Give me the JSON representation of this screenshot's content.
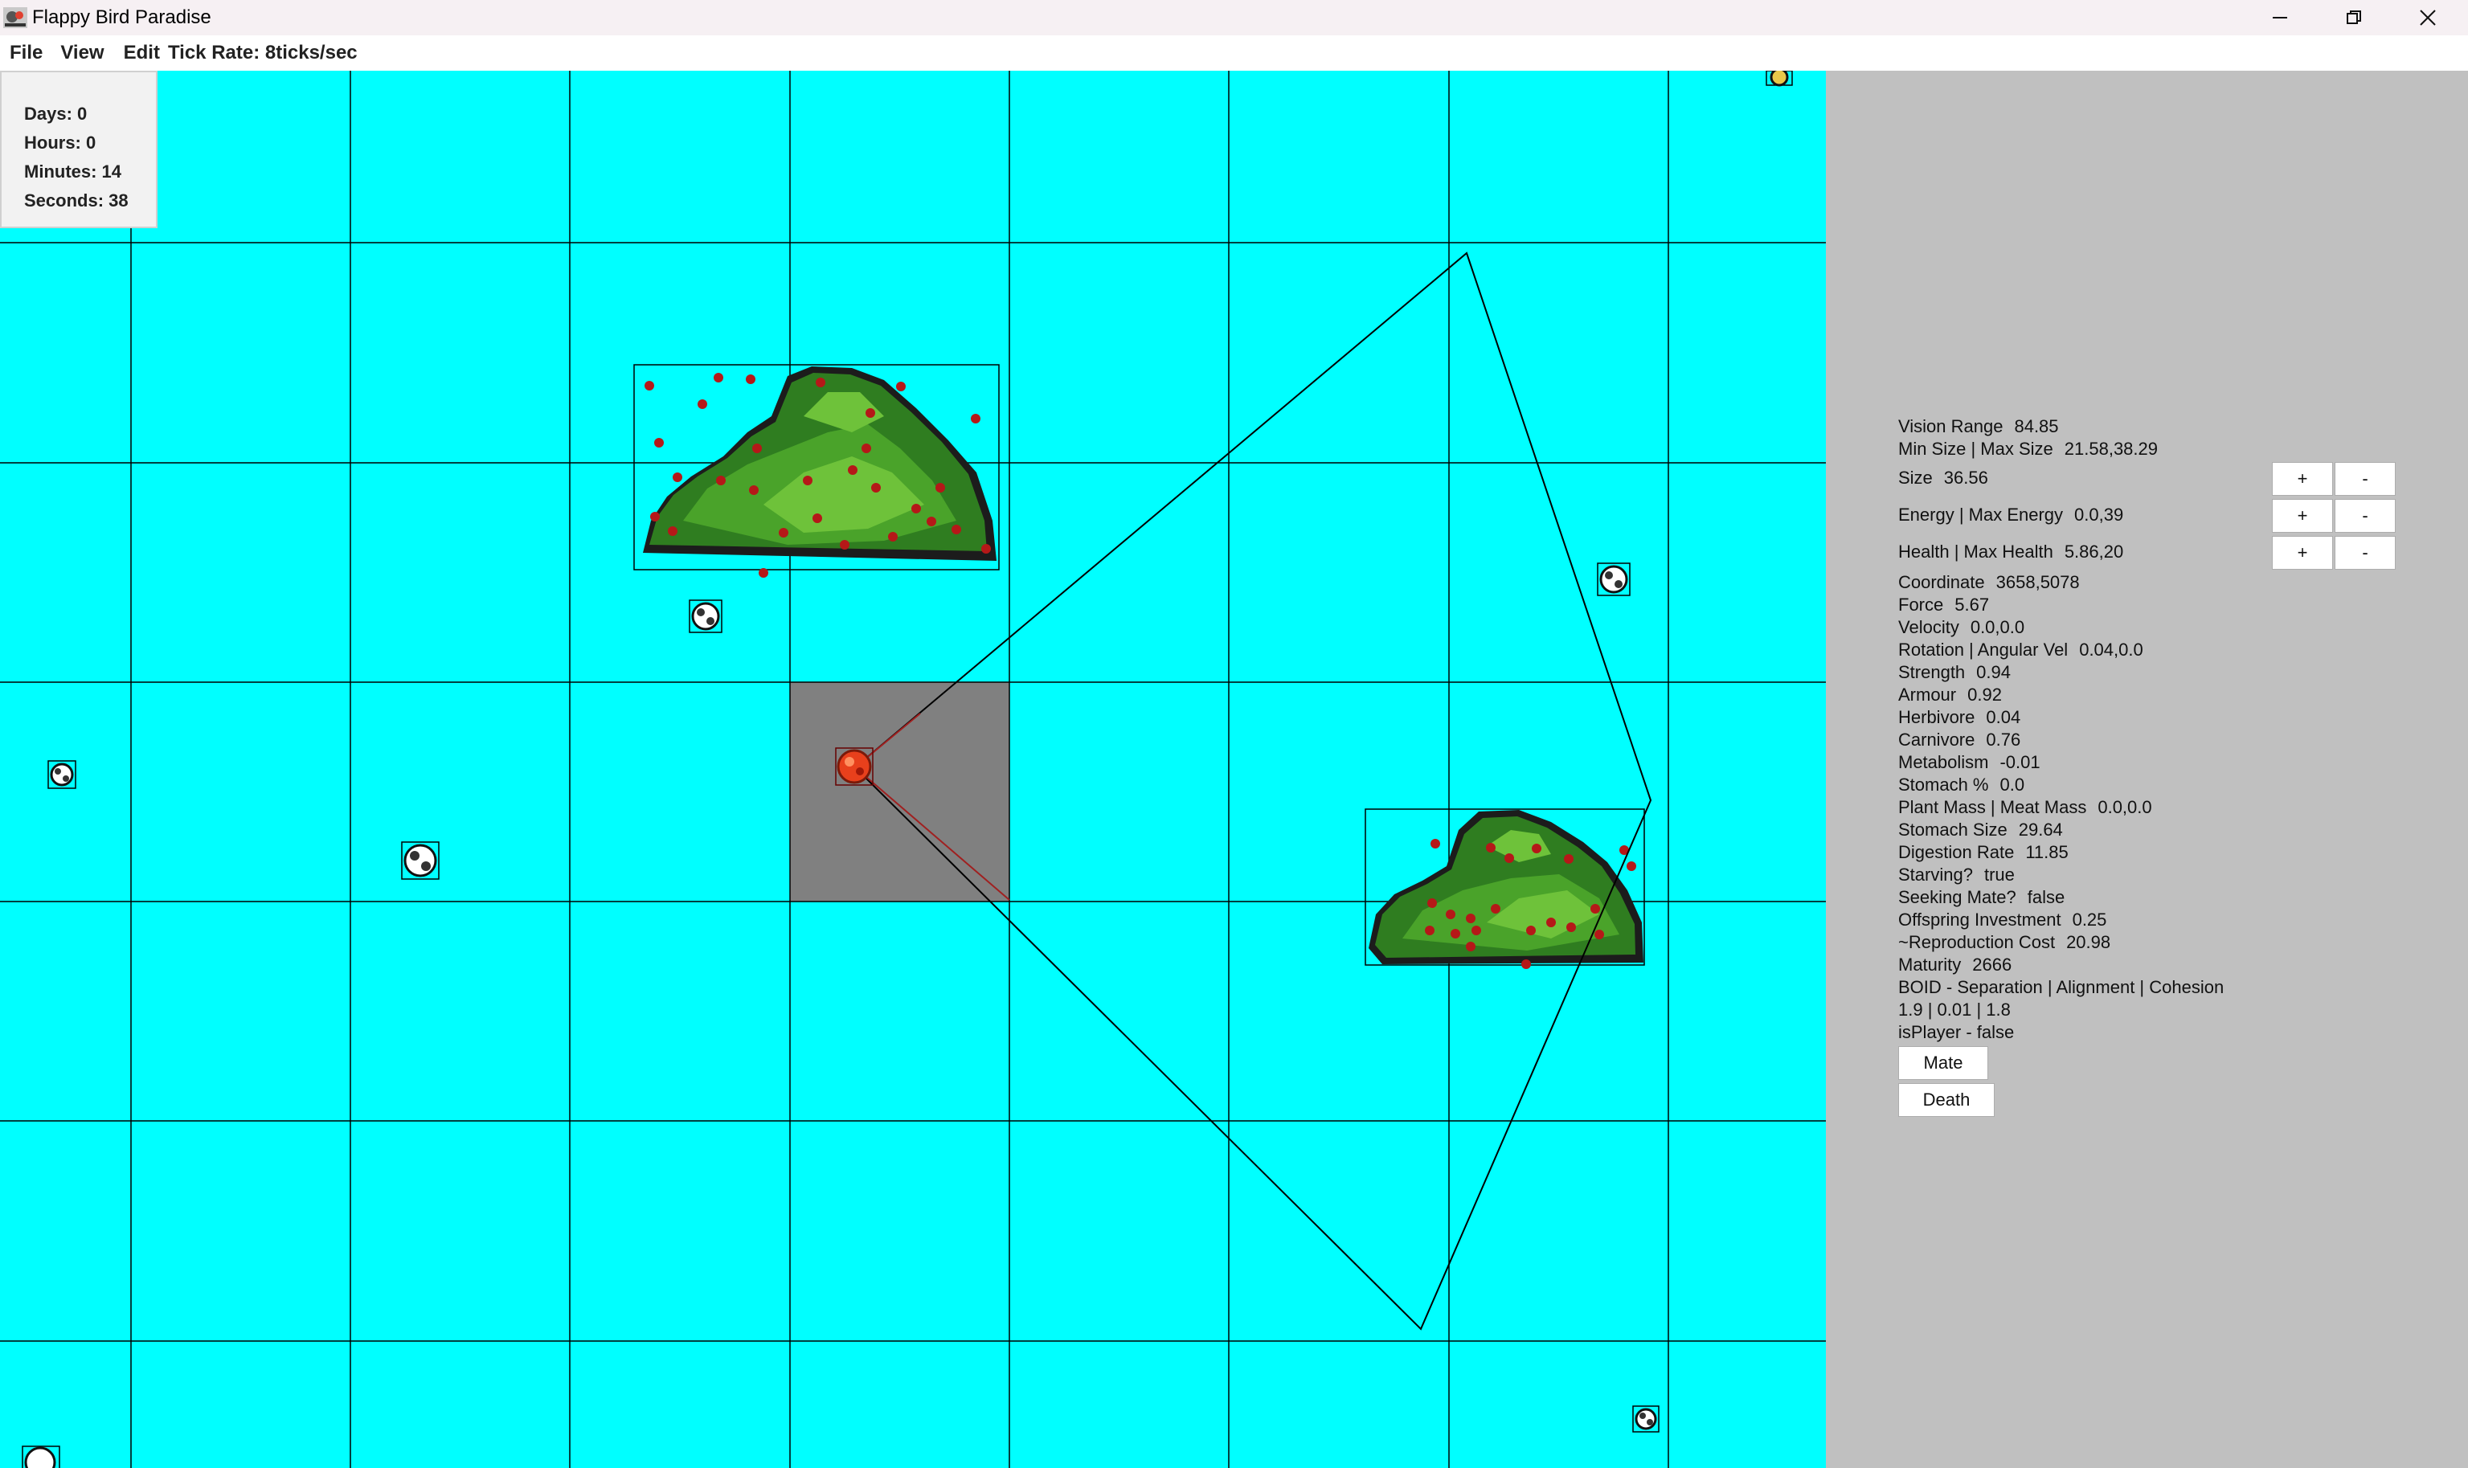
{
  "window": {
    "title": "Flappy Bird Paradise",
    "icon": "bird-app-icon",
    "controls": [
      "minimize-icon",
      "restore-icon",
      "close-icon"
    ]
  },
  "menu": {
    "file": "File",
    "view": "View",
    "edit": "Edit",
    "tick_rate": "Tick Rate: 8ticks/sec"
  },
  "time": {
    "days": "Days: 0",
    "hours": "Hours: 0",
    "minutes": "Minutes: 14",
    "seconds": "Seconds: 38"
  },
  "colors": {
    "world_background": "#00ffff",
    "grid_lines": "#000000",
    "selected_cell": "#808080",
    "side_panel": "#c0c0c0",
    "bush_dark": "#2e7d1e",
    "bush_light": "#5bb62e",
    "berry": "#b51818",
    "selected_creature": "#e8401c"
  },
  "stats": {
    "vision_range": {
      "label": "Vision Range",
      "value": "84.85"
    },
    "size_range": {
      "label": "Min Size | Max Size",
      "value": "21.58,38.29"
    },
    "size": {
      "label": "Size",
      "value": "36.56"
    },
    "energy": {
      "label": "Energy | Max Energy",
      "value": "0.0,39"
    },
    "health": {
      "label": "Health | Max Health",
      "value": "5.86,20"
    },
    "coordinate": {
      "label": "Coordinate",
      "value": "3658,5078"
    },
    "force": {
      "label": "Force",
      "value": "5.67"
    },
    "velocity": {
      "label": "Velocity",
      "value": "0.0,0.0"
    },
    "rotation": {
      "label": "Rotation | Angular Vel",
      "value": "0.04,0.0"
    },
    "strength": {
      "label": "Strength",
      "value": "0.94"
    },
    "armour": {
      "label": "Armour",
      "value": "0.92"
    },
    "herbivore": {
      "label": "Herbivore",
      "value": "0.04"
    },
    "carnivore": {
      "label": "Carnivore",
      "value": "0.76"
    },
    "metabolism": {
      "label": "Metabolism",
      "value": "-0.01"
    },
    "stomach_pct": {
      "label": "Stomach %",
      "value": "0.0"
    },
    "mass": {
      "label": "Plant Mass | Meat Mass",
      "value": "0.0,0.0"
    },
    "stomach_size": {
      "label": "Stomach Size",
      "value": "29.64"
    },
    "digestion": {
      "label": "Digestion Rate",
      "value": "11.85"
    },
    "starving": {
      "label": "Starving?",
      "value": "true"
    },
    "seeking_mate": {
      "label": "Seeking Mate?",
      "value": "false"
    },
    "offspring": {
      "label": "Offspring Investment",
      "value": "0.25"
    },
    "repro_cost": {
      "label": "~Reproduction Cost",
      "value": "20.98"
    },
    "maturity": {
      "label": "Maturity",
      "value": "2666"
    },
    "boid_label": "BOID - Separation | Alignment | Cohesion",
    "boid_values": "1.9 | 0.01 | 1.8",
    "is_player": "isPlayer - false"
  },
  "buttons": {
    "plus": "+",
    "minus": "-",
    "mate": "Mate",
    "death": "Death"
  }
}
